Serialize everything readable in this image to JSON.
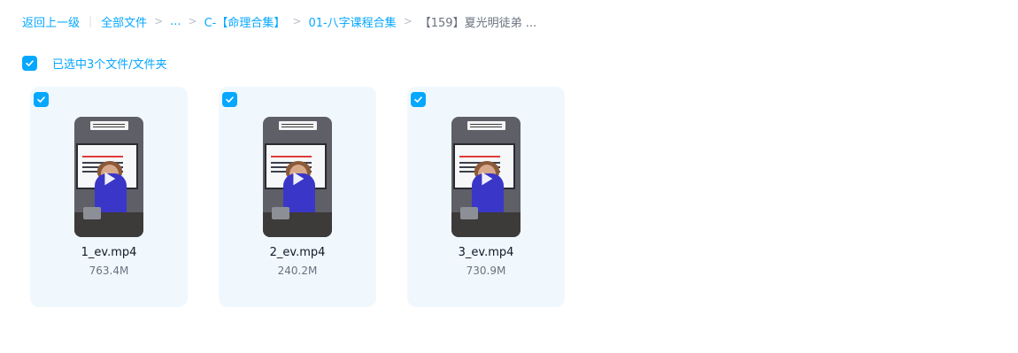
{
  "breadcrumb": {
    "back": "返回上一级",
    "root": "全部文件",
    "ellipsis": "...",
    "folder1": "C-【命理合集】",
    "folder2": "01-八字课程合集",
    "current": "【159】夏光明徒弟 ...",
    "separator": ">",
    "divider": "|"
  },
  "selection": {
    "text": "已选中3个文件/文件夹",
    "checked": true
  },
  "colors": {
    "accent": "#06a7ff",
    "card_bg": "#f0f8fd",
    "muted": "#6b7280"
  },
  "files": [
    {
      "name": "1_ev.mp4",
      "size": "763.4M",
      "checked": true,
      "icon": "video-thumbnail"
    },
    {
      "name": "2_ev.mp4",
      "size": "240.2M",
      "checked": true,
      "icon": "video-thumbnail"
    },
    {
      "name": "3_ev.mp4",
      "size": "730.9M",
      "checked": true,
      "icon": "video-thumbnail"
    }
  ]
}
